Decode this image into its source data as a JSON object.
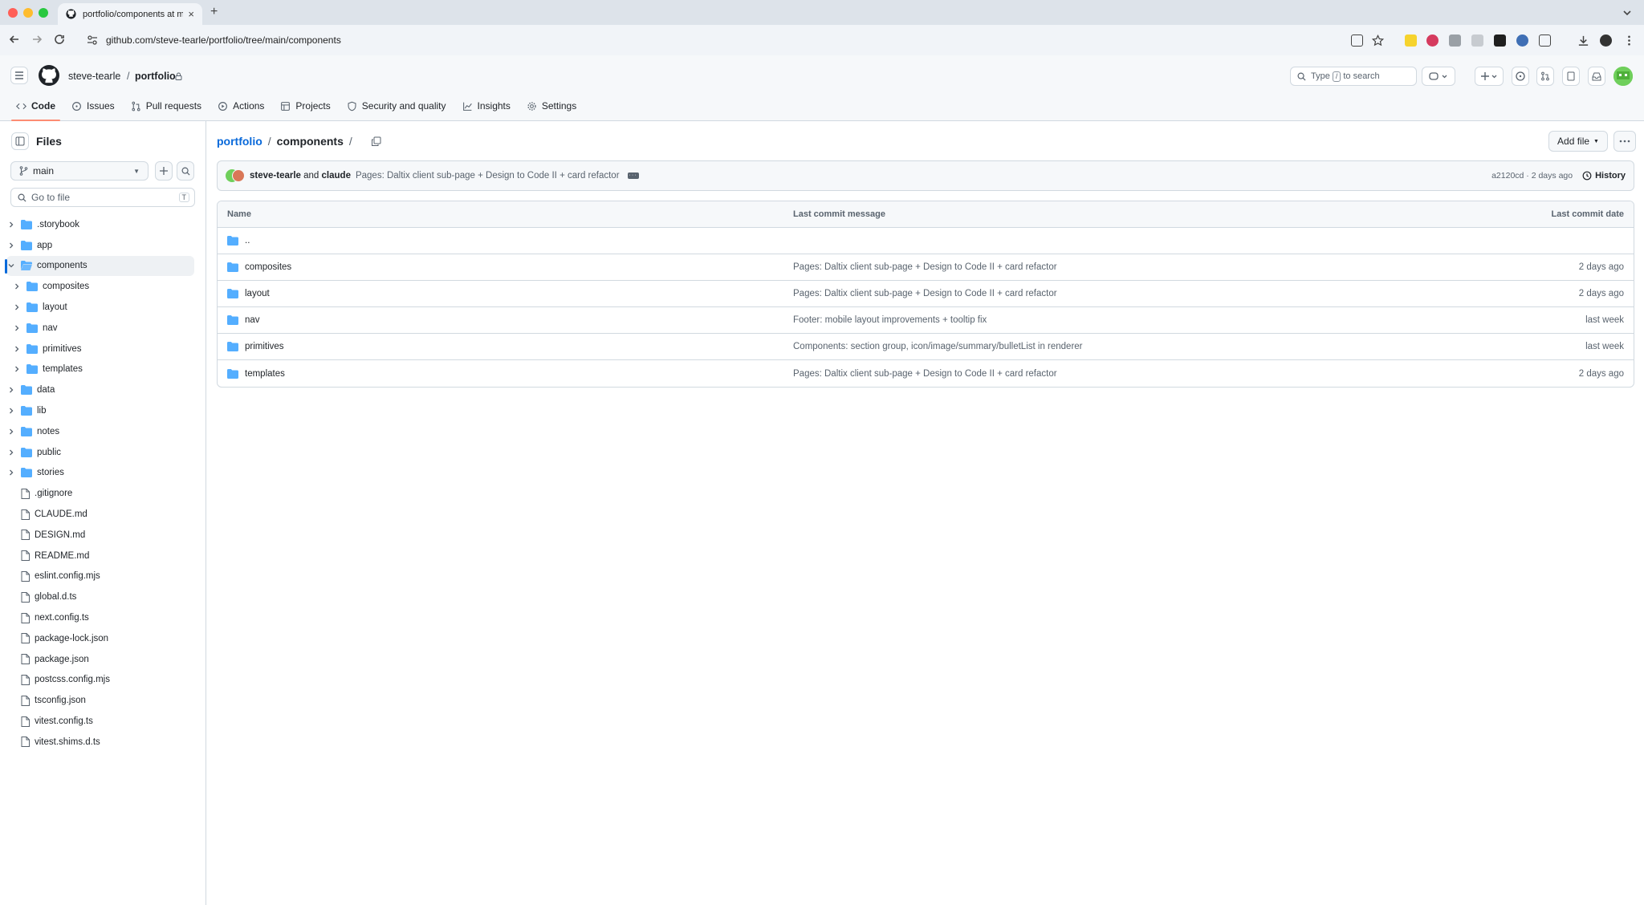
{
  "browser": {
    "tab_title": "portfolio/components at main",
    "url": "github.com/steve-tearle/portfolio/tree/main/components",
    "new_tab": "+"
  },
  "header": {
    "owner": "steve-tearle",
    "separator": "/",
    "repo": "portfolio",
    "search_prefix": "Type",
    "search_key": "/",
    "search_suffix": "to search"
  },
  "repo_nav": [
    {
      "label": "Code",
      "icon": "code-icon"
    },
    {
      "label": "Issues",
      "icon": "issue-icon"
    },
    {
      "label": "Pull requests",
      "icon": "pull-request-icon"
    },
    {
      "label": "Actions",
      "icon": "play-icon"
    },
    {
      "label": "Projects",
      "icon": "table-icon"
    },
    {
      "label": "Security and quality",
      "icon": "shield-icon"
    },
    {
      "label": "Insights",
      "icon": "graph-icon"
    },
    {
      "label": "Settings",
      "icon": "gear-icon"
    }
  ],
  "sidebar": {
    "title": "Files",
    "branch": "main",
    "goto_placeholder": "Go to file",
    "goto_key": "T",
    "tree": [
      {
        "name": ".storybook",
        "type": "folder"
      },
      {
        "name": "app",
        "type": "folder"
      },
      {
        "name": "components",
        "type": "folder-open"
      },
      {
        "name": "composites",
        "type": "folder"
      },
      {
        "name": "layout",
        "type": "folder"
      },
      {
        "name": "nav",
        "type": "folder"
      },
      {
        "name": "primitives",
        "type": "folder"
      },
      {
        "name": "templates",
        "type": "folder"
      },
      {
        "name": "data",
        "type": "folder"
      },
      {
        "name": "lib",
        "type": "folder"
      },
      {
        "name": "notes",
        "type": "folder"
      },
      {
        "name": "public",
        "type": "folder"
      },
      {
        "name": "stories",
        "type": "folder"
      },
      {
        "name": ".gitignore",
        "type": "file"
      },
      {
        "name": "CLAUDE.md",
        "type": "file"
      },
      {
        "name": "DESIGN.md",
        "type": "file"
      },
      {
        "name": "README.md",
        "type": "file"
      },
      {
        "name": "eslint.config.mjs",
        "type": "file"
      },
      {
        "name": "global.d.ts",
        "type": "file"
      },
      {
        "name": "next.config.ts",
        "type": "file"
      },
      {
        "name": "package-lock.json",
        "type": "file"
      },
      {
        "name": "package.json",
        "type": "file"
      },
      {
        "name": "postcss.config.mjs",
        "type": "file"
      },
      {
        "name": "tsconfig.json",
        "type": "file"
      },
      {
        "name": "vitest.config.ts",
        "type": "file"
      },
      {
        "name": "vitest.shims.d.ts",
        "type": "file"
      }
    ]
  },
  "main": {
    "path_repo": "portfolio",
    "path_sep": "/",
    "path_current": "components",
    "path_trailing": "/",
    "add_file": "Add file",
    "commit": {
      "author1": "steve-tearle",
      "and": "and",
      "author2": "claude",
      "message": "Pages: Daltix client sub-page + Design to Code II + card refactor",
      "sha_date": "a2120cd · 2 days ago",
      "history": "History"
    },
    "table": {
      "headers": {
        "name": "Name",
        "message": "Last commit message",
        "date": "Last commit date"
      },
      "parent": "..",
      "rows": [
        {
          "name": "composites",
          "message": "Pages: Daltix client sub-page + Design to Code II + card refactor",
          "date": "2 days ago"
        },
        {
          "name": "layout",
          "message": "Pages: Daltix client sub-page + Design to Code II + card refactor",
          "date": "2 days ago"
        },
        {
          "name": "nav",
          "message": "Footer: mobile layout improvements + tooltip fix",
          "date": "last week"
        },
        {
          "name": "primitives",
          "message": "Components: section group, icon/image/summary/bulletList in renderer",
          "date": "last week"
        },
        {
          "name": "templates",
          "message": "Pages: Daltix client sub-page + Design to Code II + card refactor",
          "date": "2 days ago"
        }
      ]
    }
  },
  "colors": {
    "folder": "#54aeff",
    "link": "#0969da",
    "accent_underline": "#fd8c73"
  }
}
